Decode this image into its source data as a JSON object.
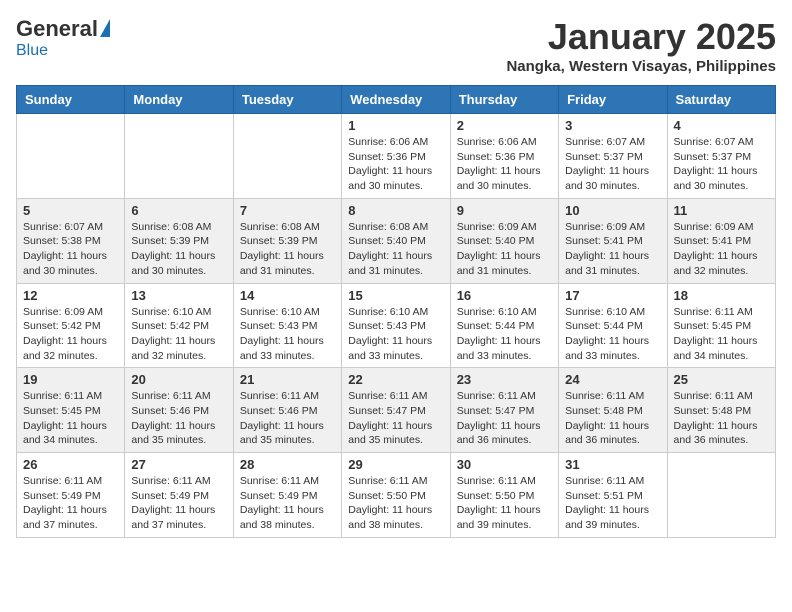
{
  "logo": {
    "general": "General",
    "blue": "Blue"
  },
  "header": {
    "month": "January 2025",
    "location": "Nangka, Western Visayas, Philippines"
  },
  "weekdays": [
    "Sunday",
    "Monday",
    "Tuesday",
    "Wednesday",
    "Thursday",
    "Friday",
    "Saturday"
  ],
  "weeks": [
    [
      {
        "day": "",
        "info": ""
      },
      {
        "day": "",
        "info": ""
      },
      {
        "day": "",
        "info": ""
      },
      {
        "day": "1",
        "info": "Sunrise: 6:06 AM\nSunset: 5:36 PM\nDaylight: 11 hours\nand 30 minutes."
      },
      {
        "day": "2",
        "info": "Sunrise: 6:06 AM\nSunset: 5:36 PM\nDaylight: 11 hours\nand 30 minutes."
      },
      {
        "day": "3",
        "info": "Sunrise: 6:07 AM\nSunset: 5:37 PM\nDaylight: 11 hours\nand 30 minutes."
      },
      {
        "day": "4",
        "info": "Sunrise: 6:07 AM\nSunset: 5:37 PM\nDaylight: 11 hours\nand 30 minutes."
      }
    ],
    [
      {
        "day": "5",
        "info": "Sunrise: 6:07 AM\nSunset: 5:38 PM\nDaylight: 11 hours\nand 30 minutes."
      },
      {
        "day": "6",
        "info": "Sunrise: 6:08 AM\nSunset: 5:39 PM\nDaylight: 11 hours\nand 30 minutes."
      },
      {
        "day": "7",
        "info": "Sunrise: 6:08 AM\nSunset: 5:39 PM\nDaylight: 11 hours\nand 31 minutes."
      },
      {
        "day": "8",
        "info": "Sunrise: 6:08 AM\nSunset: 5:40 PM\nDaylight: 11 hours\nand 31 minutes."
      },
      {
        "day": "9",
        "info": "Sunrise: 6:09 AM\nSunset: 5:40 PM\nDaylight: 11 hours\nand 31 minutes."
      },
      {
        "day": "10",
        "info": "Sunrise: 6:09 AM\nSunset: 5:41 PM\nDaylight: 11 hours\nand 31 minutes."
      },
      {
        "day": "11",
        "info": "Sunrise: 6:09 AM\nSunset: 5:41 PM\nDaylight: 11 hours\nand 32 minutes."
      }
    ],
    [
      {
        "day": "12",
        "info": "Sunrise: 6:09 AM\nSunset: 5:42 PM\nDaylight: 11 hours\nand 32 minutes."
      },
      {
        "day": "13",
        "info": "Sunrise: 6:10 AM\nSunset: 5:42 PM\nDaylight: 11 hours\nand 32 minutes."
      },
      {
        "day": "14",
        "info": "Sunrise: 6:10 AM\nSunset: 5:43 PM\nDaylight: 11 hours\nand 33 minutes."
      },
      {
        "day": "15",
        "info": "Sunrise: 6:10 AM\nSunset: 5:43 PM\nDaylight: 11 hours\nand 33 minutes."
      },
      {
        "day": "16",
        "info": "Sunrise: 6:10 AM\nSunset: 5:44 PM\nDaylight: 11 hours\nand 33 minutes."
      },
      {
        "day": "17",
        "info": "Sunrise: 6:10 AM\nSunset: 5:44 PM\nDaylight: 11 hours\nand 33 minutes."
      },
      {
        "day": "18",
        "info": "Sunrise: 6:11 AM\nSunset: 5:45 PM\nDaylight: 11 hours\nand 34 minutes."
      }
    ],
    [
      {
        "day": "19",
        "info": "Sunrise: 6:11 AM\nSunset: 5:45 PM\nDaylight: 11 hours\nand 34 minutes."
      },
      {
        "day": "20",
        "info": "Sunrise: 6:11 AM\nSunset: 5:46 PM\nDaylight: 11 hours\nand 35 minutes."
      },
      {
        "day": "21",
        "info": "Sunrise: 6:11 AM\nSunset: 5:46 PM\nDaylight: 11 hours\nand 35 minutes."
      },
      {
        "day": "22",
        "info": "Sunrise: 6:11 AM\nSunset: 5:47 PM\nDaylight: 11 hours\nand 35 minutes."
      },
      {
        "day": "23",
        "info": "Sunrise: 6:11 AM\nSunset: 5:47 PM\nDaylight: 11 hours\nand 36 minutes."
      },
      {
        "day": "24",
        "info": "Sunrise: 6:11 AM\nSunset: 5:48 PM\nDaylight: 11 hours\nand 36 minutes."
      },
      {
        "day": "25",
        "info": "Sunrise: 6:11 AM\nSunset: 5:48 PM\nDaylight: 11 hours\nand 36 minutes."
      }
    ],
    [
      {
        "day": "26",
        "info": "Sunrise: 6:11 AM\nSunset: 5:49 PM\nDaylight: 11 hours\nand 37 minutes."
      },
      {
        "day": "27",
        "info": "Sunrise: 6:11 AM\nSunset: 5:49 PM\nDaylight: 11 hours\nand 37 minutes."
      },
      {
        "day": "28",
        "info": "Sunrise: 6:11 AM\nSunset: 5:49 PM\nDaylight: 11 hours\nand 38 minutes."
      },
      {
        "day": "29",
        "info": "Sunrise: 6:11 AM\nSunset: 5:50 PM\nDaylight: 11 hours\nand 38 minutes."
      },
      {
        "day": "30",
        "info": "Sunrise: 6:11 AM\nSunset: 5:50 PM\nDaylight: 11 hours\nand 39 minutes."
      },
      {
        "day": "31",
        "info": "Sunrise: 6:11 AM\nSunset: 5:51 PM\nDaylight: 11 hours\nand 39 minutes."
      },
      {
        "day": "",
        "info": ""
      }
    ]
  ]
}
